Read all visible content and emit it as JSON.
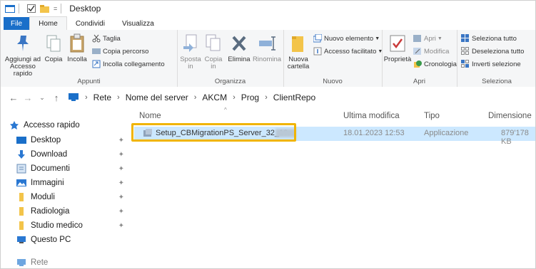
{
  "window": {
    "title": "Desktop"
  },
  "tabs": {
    "file": "File",
    "home": "Home",
    "share": "Condividi",
    "view": "Visualizza"
  },
  "ribbon": {
    "clipboard": {
      "label": "Appunti",
      "pin_quick": "Aggiungi ad\nAccesso rapido",
      "copy": "Copia",
      "paste": "Incolla",
      "cut": "Taglia",
      "copy_path": "Copia percorso",
      "paste_shortcut": "Incolla collegamento"
    },
    "organize": {
      "label": "Organizza",
      "move_to": "Sposta\nin",
      "copy_to": "Copia\nin",
      "delete": "Elimina",
      "rename": "Rinomina"
    },
    "new": {
      "label": "Nuovo",
      "new_folder": "Nuova\ncartella",
      "new_item": "Nuovo elemento",
      "easy_access": "Accesso facilitato"
    },
    "open": {
      "label": "Apri",
      "properties": "Proprietà",
      "open": "Apri",
      "edit": "Modifica",
      "history": "Cronologia"
    },
    "select": {
      "label": "Seleziona",
      "select_all": "Seleziona tutto",
      "select_none": "Deseleziona tutto",
      "invert": "Inverti selezione"
    }
  },
  "address": {
    "crumbs": [
      "Rete",
      "Nome del server",
      "AKCM",
      "Prog",
      "ClientRepo"
    ]
  },
  "sidebar": {
    "items": [
      {
        "label": "Accesso rapido",
        "icon": "star-icon"
      },
      {
        "label": "Desktop",
        "icon": "desktop-icon"
      },
      {
        "label": "Download",
        "icon": "download-icon"
      },
      {
        "label": "Documenti",
        "icon": "documents-icon"
      },
      {
        "label": "Immagini",
        "icon": "pictures-icon"
      },
      {
        "label": "Moduli",
        "icon": "folder-icon"
      },
      {
        "label": "Radiologia",
        "icon": "folder-icon"
      },
      {
        "label": "Studio medico",
        "icon": "folder-icon"
      },
      {
        "label": "Questo PC",
        "icon": "pc-icon"
      },
      {
        "label": "Rete",
        "icon": "network-icon"
      }
    ]
  },
  "columns": {
    "name": "Nome",
    "modified": "Ultima modifica",
    "type": "Tipo",
    "size": "Dimensione"
  },
  "files": [
    {
      "name": "Setup_CBMigrationPS_Server_32_10.",
      "modified": "18.01.2023 12:53",
      "type": "Applicazione",
      "size": "879'178 KB"
    }
  ],
  "colors": {
    "accent": "#1a6fc9",
    "highlight_border": "#f0b400",
    "selection": "#cce8ff"
  }
}
